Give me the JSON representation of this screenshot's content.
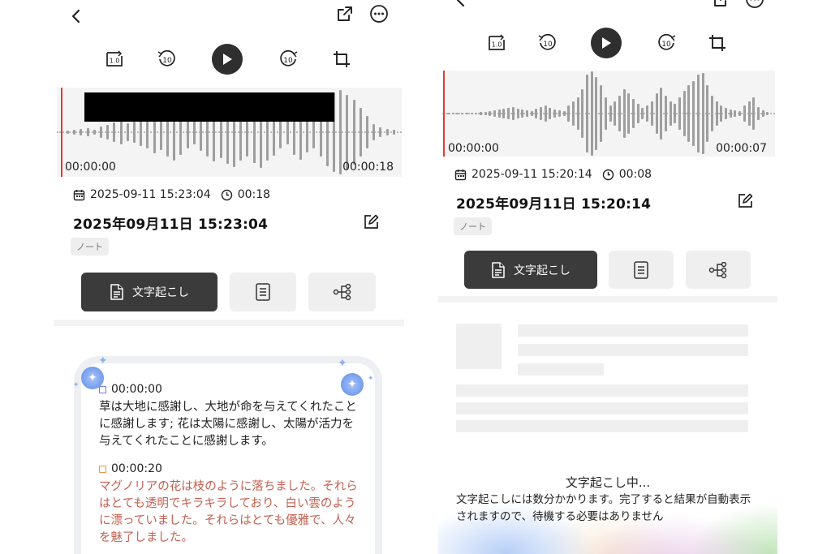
{
  "left": {
    "player": {
      "speed_label": "1.0",
      "rewind_label": "10",
      "forward_label": "10"
    },
    "waveform": {
      "start_time": "00:00:00",
      "end_time": "00:00:18"
    },
    "meta": {
      "datetime": "2025-09-11 15:23:04",
      "duration": "00:18"
    },
    "title": "2025年09月11日 15:23:04",
    "tag": "ノート",
    "tabs": {
      "transcript_label": "文字起こし"
    },
    "transcript": [
      {
        "time": "00:00:00",
        "text": "草は大地に感謝し、大地が命を与えてくれたことに感謝します; 花は太陽に感謝し、太陽が活力を与えてくれたことに感謝します。",
        "marker_color": "#6f7bd6"
      },
      {
        "time": "00:00:20",
        "text": "マグノリアの花は枝のように落ちました。それらはとても透明でキラキラしており、白い雲のように漂っていました。それらはとても優雅で、人々を魅了しました。",
        "marker_color": "#e39a4a"
      }
    ]
  },
  "right": {
    "player": {
      "speed_label": "1.0",
      "rewind_label": "10",
      "forward_label": "10"
    },
    "waveform": {
      "start_time": "00:00:00",
      "end_time": "00:00:07"
    },
    "meta": {
      "datetime": "2025-09-11 15:20:14",
      "duration": "00:08"
    },
    "title": "2025年09月11日 15:20:14",
    "tag": "ノート",
    "tabs": {
      "transcript_label": "文字起こし"
    },
    "status": {
      "heading": "文字起こし中...",
      "message": "文字起こしには数分かかります。完了すると結果が自動表示されますので、待機する必要はありません"
    }
  },
  "colors": {
    "accent_dark": "#3b3b3b",
    "playhead": "#e53935",
    "red_text": "#c4604f"
  }
}
